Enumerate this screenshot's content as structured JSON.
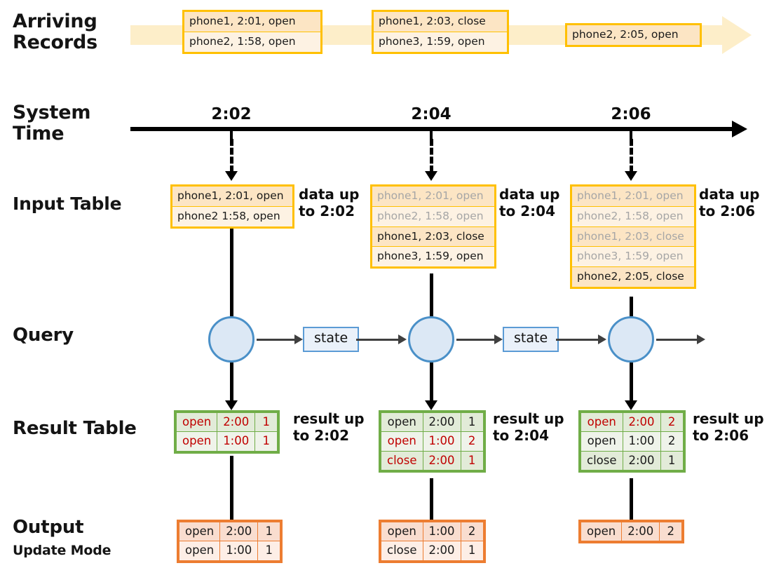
{
  "rows": {
    "arriving_records_label": "Arriving\nRecords",
    "system_time_label": "System\nTime",
    "input_table_label": "Input Table",
    "query_label": "Query",
    "result_table_label": "Result Table",
    "output_label": "Output",
    "output_sublabel": "Update Mode"
  },
  "colors": {
    "record_border": "#ffc000",
    "record_fill": "#fdf2e3",
    "record_fill_shade": "#fce5c4",
    "band_fill": "#fdeec9",
    "dim_text": "#a6a6a6",
    "result_border": "#70ad47",
    "result_fill": "#eff3ea",
    "result_fill_shade": "#e2ebd8",
    "highlight_red": "#c00000",
    "output_border": "#ed7d31",
    "output_fill": "#fdeee6",
    "output_fill_shade": "#f9ddcf",
    "state_border": "#5b9bd5",
    "state_fill": "#eaf1fa",
    "circle_fill": "#dce8f5",
    "circle_border": "#4a90c8",
    "arrow_black": "#000000"
  },
  "arriving_records": [
    {
      "id": "batch-1",
      "lines": [
        "phone1, 2:01, open",
        "phone2, 1:58, open"
      ]
    },
    {
      "id": "batch-2",
      "lines": [
        "phone1, 2:03, close",
        "phone3, 1:59, open"
      ]
    },
    {
      "id": "batch-3",
      "lines": [
        "phone2, 2:05, open"
      ]
    }
  ],
  "system_times": [
    "2:02",
    "2:04",
    "2:06"
  ],
  "input_tables": [
    {
      "trigger": "2:02",
      "annotation": "data up\nto 2:02",
      "rows": [
        {
          "text": "phone1, 2:01, open",
          "dim": false
        },
        {
          "text": "phone2 1:58, open",
          "dim": false
        }
      ]
    },
    {
      "trigger": "2:04",
      "annotation": "data up\nto 2:04",
      "rows": [
        {
          "text": "phone1, 2:01, open",
          "dim": true
        },
        {
          "text": "phone2, 1:58, open",
          "dim": true
        },
        {
          "text": "phone1, 2:03, close",
          "dim": false
        },
        {
          "text": "phone3, 1:59, open",
          "dim": false
        }
      ]
    },
    {
      "trigger": "2:06",
      "annotation": "data up\nto 2:06",
      "rows": [
        {
          "text": "phone1, 2:01, open",
          "dim": true
        },
        {
          "text": "phone2, 1:58, open",
          "dim": true
        },
        {
          "text": "phone1, 2:03, close",
          "dim": true
        },
        {
          "text": "phone3, 1:59, open",
          "dim": true
        },
        {
          "text": "phone2, 2:05, close",
          "dim": false
        }
      ]
    }
  ],
  "query": {
    "state_label_1": "state",
    "state_label_2": "state"
  },
  "result_tables": [
    {
      "trigger": "2:02",
      "annotation": "result up\nto 2:02",
      "rows": [
        {
          "cells": [
            "open",
            "2:00",
            "1"
          ],
          "changed": true
        },
        {
          "cells": [
            "open",
            "1:00",
            "1"
          ],
          "changed": true
        }
      ]
    },
    {
      "trigger": "2:04",
      "annotation": "result up\nto 2:04",
      "rows": [
        {
          "cells": [
            "open",
            "2:00",
            "1"
          ],
          "changed": false
        },
        {
          "cells": [
            "open",
            "1:00",
            "2"
          ],
          "changed": true
        },
        {
          "cells": [
            "close",
            "2:00",
            "1"
          ],
          "changed": true
        }
      ]
    },
    {
      "trigger": "2:06",
      "annotation": "result up\nto 2:06",
      "rows": [
        {
          "cells": [
            "open",
            "2:00",
            "2"
          ],
          "changed": true
        },
        {
          "cells": [
            "open",
            "1:00",
            "2"
          ],
          "changed": false
        },
        {
          "cells": [
            "close",
            "2:00",
            "1"
          ],
          "changed": false
        }
      ]
    }
  ],
  "output_tables": [
    {
      "trigger": "2:02",
      "rows": [
        {
          "cells": [
            "open",
            "2:00",
            "1"
          ]
        },
        {
          "cells": [
            "open",
            "1:00",
            "1"
          ]
        }
      ]
    },
    {
      "trigger": "2:04",
      "rows": [
        {
          "cells": [
            "open",
            "1:00",
            "2"
          ]
        },
        {
          "cells": [
            "close",
            "2:00",
            "1"
          ]
        }
      ]
    },
    {
      "trigger": "2:06",
      "rows": [
        {
          "cells": [
            "open",
            "2:00",
            "2"
          ]
        }
      ]
    }
  ]
}
